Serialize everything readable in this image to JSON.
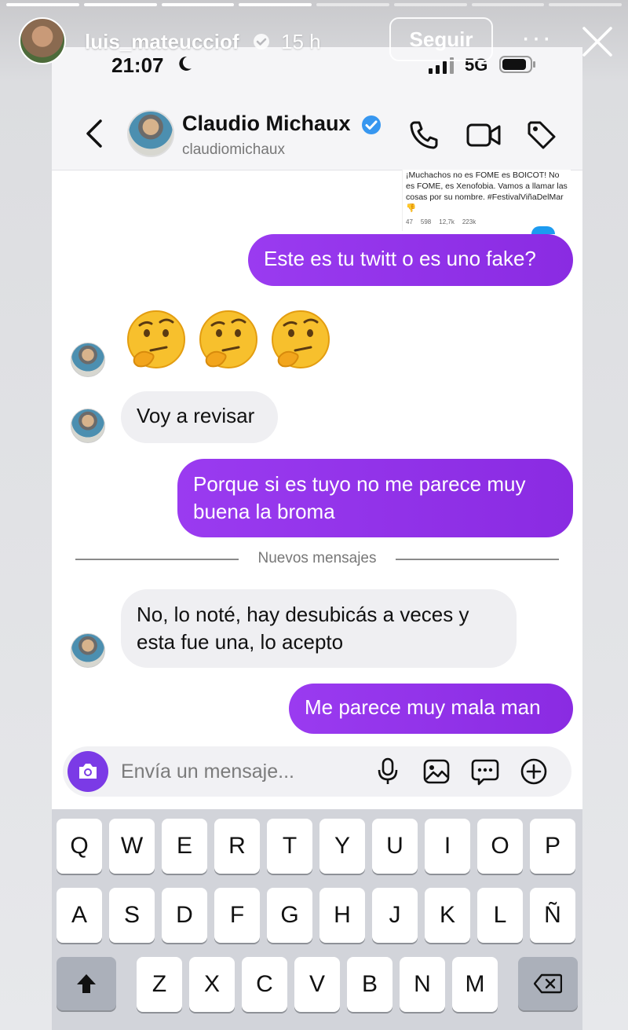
{
  "story": {
    "username": "luis_mateucciof",
    "time_ago": "15 h",
    "follow_label": "Seguir",
    "more_glyph": "···",
    "segments_done": 4,
    "segments_total": 8
  },
  "status_bar": {
    "time": "21:07",
    "network": "5G"
  },
  "chat": {
    "contact_name": "Claudio Michaux",
    "contact_handle": "claudiomichaux",
    "shared_tweet": {
      "text": "¡Muchachos no es FOME es BOICOT! No es FOME, es Xenofobia. Vamos a llamar las cosas por su nombre. #FestivalViñaDelMar 👎",
      "stats": [
        "47",
        "598",
        "12,7k",
        "223k"
      ]
    },
    "messages": [
      {
        "from": "me",
        "text": "Este es tu twitt o es uno fake?"
      },
      {
        "from": "them",
        "text": "🤔🤔🤔"
      },
      {
        "from": "them",
        "text": "Voy a revisar"
      },
      {
        "from": "me",
        "text": "Porque si es tuyo no me parece muy buena la broma"
      },
      {
        "from": "them",
        "text": "No, lo noté, hay desubicás a veces y esta fue una, lo acepto"
      },
      {
        "from": "me",
        "text": "Me parece muy mala man"
      }
    ],
    "new_messages_label": "Nuevos mensajes",
    "composer_placeholder": "Envía un mensaje..."
  },
  "keyboard": {
    "row1": [
      "Q",
      "W",
      "E",
      "R",
      "T",
      "Y",
      "U",
      "I",
      "O",
      "P"
    ],
    "row2": [
      "A",
      "S",
      "D",
      "F",
      "G",
      "H",
      "J",
      "K",
      "L",
      "Ñ"
    ],
    "row3": [
      "Z",
      "X",
      "C",
      "V",
      "B",
      "N",
      "M"
    ]
  },
  "colors": {
    "sent_bubble": "#8f2ee6",
    "received_bubble": "#efeff2",
    "accent": "#7b3ae6",
    "verified": "#3797f0"
  }
}
